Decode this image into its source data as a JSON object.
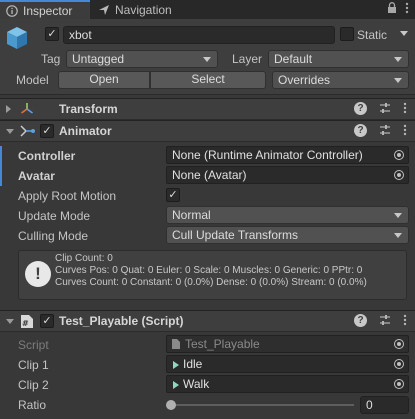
{
  "tabs": {
    "inspector": "Inspector",
    "navigation": "Navigation"
  },
  "tab_icons": {
    "inspector": "info-icon",
    "navigation": "compass-icon",
    "lock": "lock-icon",
    "menu": "kebab-menu-icon"
  },
  "gameobject": {
    "active": true,
    "name": "xbot",
    "static_label": "Static",
    "static_checked": false,
    "tag_label": "Tag",
    "tag_value": "Untagged",
    "layer_label": "Layer",
    "layer_value": "Default",
    "model_label": "Model",
    "open_button": "Open",
    "select_button": "Select",
    "overrides_value": "Overrides"
  },
  "transform": {
    "title": "Transform"
  },
  "animator": {
    "title": "Animator",
    "enabled": true,
    "controller_label": "Controller",
    "controller_value": "None (Runtime Animator Controller)",
    "avatar_label": "Avatar",
    "avatar_value": "None (Avatar)",
    "apply_root_motion_label": "Apply Root Motion",
    "apply_root_motion_checked": true,
    "update_mode_label": "Update Mode",
    "update_mode_value": "Normal",
    "culling_mode_label": "Culling Mode",
    "culling_mode_value": "Cull Update Transforms",
    "info_lines": [
      "Clip Count: 0",
      "Curves Pos: 0 Quat: 0 Euler: 0 Scale: 0 Muscles: 0 Generic: 0 PPtr: 0",
      "Curves Count: 0 Constant: 0 (0.0%) Dense: 0 (0.0%) Stream: 0 (0.0%)"
    ]
  },
  "script_component": {
    "title": "Test_Playable (Script)",
    "enabled": true,
    "script_label": "Script",
    "script_value": "Test_Playable",
    "clip1_label": "Clip 1",
    "clip1_value": "Idle",
    "clip2_label": "Clip 2",
    "clip2_value": "Walk",
    "ratio_label": "Ratio",
    "ratio_value": "0"
  },
  "colors": {
    "accent": "#4a86d8",
    "background": "#383838",
    "header": "#3e3e3e"
  }
}
